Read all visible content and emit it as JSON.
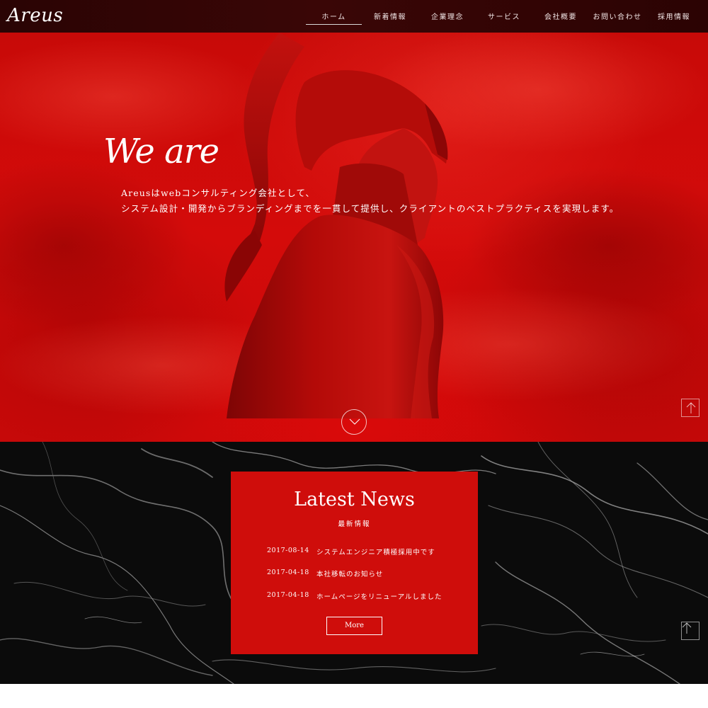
{
  "header": {
    "logo": "Areus",
    "nav": [
      {
        "label": "ホーム",
        "active": true
      },
      {
        "label": "新着情報"
      },
      {
        "label": "企業理念"
      },
      {
        "label": "サービス"
      },
      {
        "label": "会社概要"
      },
      {
        "label": "お問い合わせ"
      },
      {
        "label": "採用情報"
      }
    ]
  },
  "hero": {
    "heading": "We are",
    "lines": [
      "Areusはwebコンサルティング会社として、",
      "システム設計・開発からブランディングまでを一貫して提供し、クライアントのベストプラクティスを実現します。"
    ],
    "scroll_icon": "chevron-down-icon",
    "page_top_icon": "arrow-up-icon"
  },
  "news": {
    "title": "Latest News",
    "subtitle": "最新情報",
    "items": [
      {
        "date": "2017-08-14",
        "text": "システムエンジニア積極採用中です"
      },
      {
        "date": "2017-04-18",
        "text": "本社移転のお知らせ"
      },
      {
        "date": "2017-04-18",
        "text": "ホームページをリニューアルしました"
      }
    ],
    "more_label": "More"
  },
  "colors": {
    "header_bg": "#2f0505",
    "hero_red": "#d00b0a",
    "card_red": "#cf0d0b",
    "marble_black": "#0b0b0b",
    "text": "#ffffff"
  }
}
